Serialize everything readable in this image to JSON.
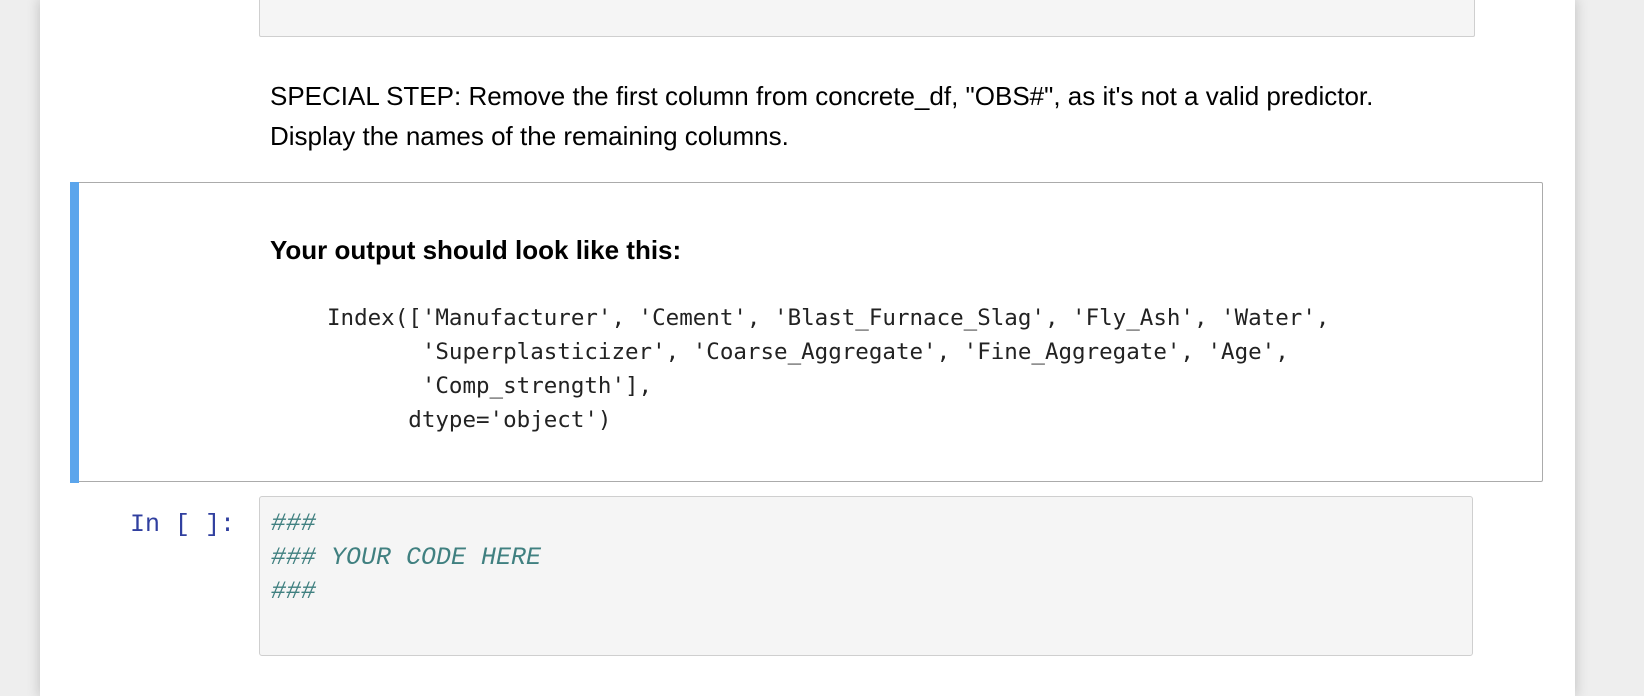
{
  "markdown_cell": {
    "line1": "SPECIAL STEP: Remove the first column from concrete_df, \"OBS#\", as it's not a valid predictor.",
    "line2": "Display the names of the remaining columns."
  },
  "expected_output_cell": {
    "heading": "Your output should look like this:",
    "code": "Index(['Manufacturer', 'Cement', 'Blast_Furnace_Slag', 'Fly_Ash', 'Water',\n       'Superplasticizer', 'Coarse_Aggregate', 'Fine_Aggregate', 'Age',\n       'Comp_strength'],\n      dtype='object')",
    "accent_color": "#5ba5ec"
  },
  "code_cell": {
    "prompt": "In [ ]:",
    "lines": [
      "###",
      "### YOUR CODE HERE",
      "###"
    ],
    "comment_color": "#408080"
  }
}
